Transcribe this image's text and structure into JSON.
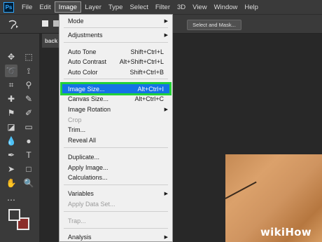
{
  "app": {
    "logo": "Ps"
  },
  "menubar": {
    "items": [
      "File",
      "Edit",
      "Image",
      "Layer",
      "Type",
      "Select",
      "Filter",
      "3D",
      "View",
      "Window",
      "Help"
    ]
  },
  "options": {
    "select_mask_label": "Select and Mask..."
  },
  "document": {
    "tab_label": "back"
  },
  "image_menu": {
    "items": [
      {
        "label": "Mode",
        "shortcut": "",
        "submenu": true,
        "disabled": false
      },
      {
        "label": "Adjustments",
        "shortcut": "",
        "submenu": true,
        "disabled": false
      },
      {
        "label": "Auto Tone",
        "shortcut": "Shift+Ctrl+L",
        "submenu": false,
        "disabled": false
      },
      {
        "label": "Auto Contrast",
        "shortcut": "Alt+Shift+Ctrl+L",
        "submenu": false,
        "disabled": false
      },
      {
        "label": "Auto Color",
        "shortcut": "Shift+Ctrl+B",
        "submenu": false,
        "disabled": false
      },
      {
        "label": "Image Size...",
        "shortcut": "Alt+Ctrl+I",
        "submenu": false,
        "disabled": false,
        "highlighted": true
      },
      {
        "label": "Canvas Size...",
        "shortcut": "Alt+Ctrl+C",
        "submenu": false,
        "disabled": false
      },
      {
        "label": "Image Rotation",
        "shortcut": "",
        "submenu": true,
        "disabled": false
      },
      {
        "label": "Crop",
        "shortcut": "",
        "submenu": false,
        "disabled": true
      },
      {
        "label": "Trim...",
        "shortcut": "",
        "submenu": false,
        "disabled": false
      },
      {
        "label": "Reveal All",
        "shortcut": "",
        "submenu": false,
        "disabled": false
      },
      {
        "label": "Duplicate...",
        "shortcut": "",
        "submenu": false,
        "disabled": false
      },
      {
        "label": "Apply Image...",
        "shortcut": "",
        "submenu": false,
        "disabled": false
      },
      {
        "label": "Calculations...",
        "shortcut": "",
        "submenu": false,
        "disabled": false
      },
      {
        "label": "Variables",
        "shortcut": "",
        "submenu": true,
        "disabled": false
      },
      {
        "label": "Apply Data Set...",
        "shortcut": "",
        "submenu": false,
        "disabled": true
      },
      {
        "label": "Trap...",
        "shortcut": "",
        "submenu": false,
        "disabled": true
      },
      {
        "label": "Analysis",
        "shortcut": "",
        "submenu": true,
        "disabled": false
      }
    ]
  },
  "watermark": {
    "wiki": "wiki",
    "how": "How"
  },
  "colors": {
    "highlight": "#1473e6",
    "callout": "#22d13a",
    "background_swatch": "#8b2d2a"
  }
}
